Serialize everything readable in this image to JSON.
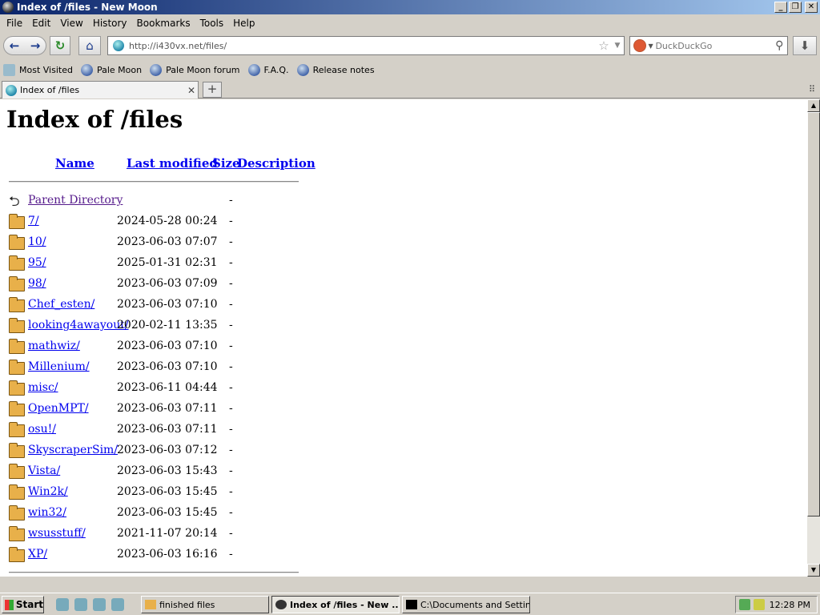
{
  "window": {
    "title": "Index of /files - New Moon"
  },
  "menubar": [
    "File",
    "Edit",
    "View",
    "History",
    "Bookmarks",
    "Tools",
    "Help"
  ],
  "navbar": {
    "url": "http://i430vx.net/files/",
    "search_placeholder": "DuckDuckGo"
  },
  "bookmarks": [
    "Most Visited",
    "Pale Moon",
    "Pale Moon forum",
    "F.A.Q.",
    "Release notes"
  ],
  "tab": {
    "label": "Index of /files"
  },
  "page": {
    "heading": "Index of /files",
    "columns": {
      "name": "Name",
      "last_modified": "Last modified",
      "size": "Size",
      "description": "Description"
    },
    "parent": {
      "name": "Parent Directory",
      "size": "-"
    },
    "entries": [
      {
        "name": "7/",
        "date": "2024-05-28 00:24",
        "size": "-"
      },
      {
        "name": "10/",
        "date": "2023-06-03 07:07",
        "size": "-"
      },
      {
        "name": "95/",
        "date": "2025-01-31 02:31",
        "size": "-"
      },
      {
        "name": "98/",
        "date": "2023-06-03 07:09",
        "size": "-"
      },
      {
        "name": "Chef_esten/",
        "date": "2023-06-03 07:10",
        "size": "-"
      },
      {
        "name": "looking4awayout/",
        "date": "2020-02-11 13:35",
        "size": "-"
      },
      {
        "name": "mathwiz/",
        "date": "2023-06-03 07:10",
        "size": "-"
      },
      {
        "name": "Millenium/",
        "date": "2023-06-03 07:10",
        "size": "-"
      },
      {
        "name": "misc/",
        "date": "2023-06-11 04:44",
        "size": "-"
      },
      {
        "name": "OpenMPT/",
        "date": "2023-06-03 07:11",
        "size": "-"
      },
      {
        "name": "osu!/",
        "date": "2023-06-03 07:11",
        "size": "-"
      },
      {
        "name": "SkyscraperSim/",
        "date": "2023-06-03 07:12",
        "size": "-"
      },
      {
        "name": "Vista/",
        "date": "2023-06-03 15:43",
        "size": "-"
      },
      {
        "name": "Win2k/",
        "date": "2023-06-03 15:45",
        "size": "-"
      },
      {
        "name": "win32/",
        "date": "2023-06-03 15:45",
        "size": "-"
      },
      {
        "name": "wsusstuff/",
        "date": "2021-11-07 20:14",
        "size": "-"
      },
      {
        "name": "XP/",
        "date": "2023-06-03 16:16",
        "size": "-"
      }
    ]
  },
  "taskbar": {
    "start": "Start",
    "buttons": [
      "finished files",
      "Index of /files - New ...",
      "C:\\Documents and Setting..."
    ],
    "clock": "12:28 PM"
  }
}
